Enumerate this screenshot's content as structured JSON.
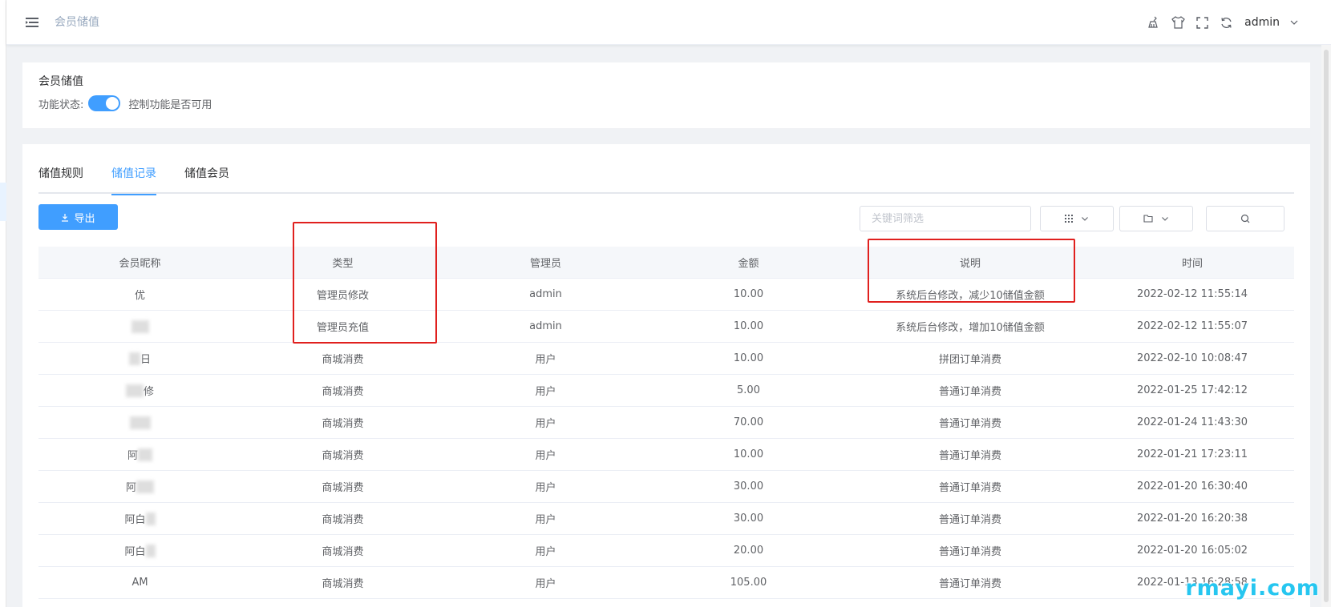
{
  "header": {
    "breadcrumb": "会员储值",
    "username": "admin"
  },
  "status_card": {
    "title": "会员储值",
    "status_label": "功能状态:",
    "switch_on": true,
    "switch_hint": "控制功能是否可用"
  },
  "tabs": [
    {
      "label": "储值规则"
    },
    {
      "label": "储值记录"
    },
    {
      "label": "储值会员"
    }
  ],
  "toolbar": {
    "export_label": "导出",
    "keyword_placeholder": "关键词筛选"
  },
  "table": {
    "columns": [
      "会员昵称",
      "类型",
      "管理员",
      "金额",
      "说明",
      "时间"
    ],
    "rows": [
      {
        "nickname": "优",
        "type": "管理员修改",
        "admin": "admin",
        "amount": "10.00",
        "note": "系统后台修改，减少10储值金额",
        "time": "2022-02-12 11:55:14"
      },
      {
        "nickname": "",
        "type": "管理员充值",
        "admin": "admin",
        "amount": "10.00",
        "note": "系统后台修改，增加10储值金额",
        "time": "2022-02-12 11:55:07"
      },
      {
        "nickname": "日",
        "type": "商城消费",
        "admin": "用户",
        "amount": "10.00",
        "note": "拼团订单消费",
        "time": "2022-02-10 10:08:47"
      },
      {
        "nickname": "修",
        "type": "商城消费",
        "admin": "用户",
        "amount": "5.00",
        "note": "普通订单消费",
        "time": "2022-01-25 17:42:12"
      },
      {
        "nickname": "",
        "type": "商城消费",
        "admin": "用户",
        "amount": "70.00",
        "note": "普通订单消费",
        "time": "2022-01-24 11:43:30"
      },
      {
        "nickname": "阿",
        "type": "商城消费",
        "admin": "用户",
        "amount": "10.00",
        "note": "普通订单消费",
        "time": "2022-01-21 17:23:11"
      },
      {
        "nickname": "阿",
        "type": "商城消费",
        "admin": "用户",
        "amount": "30.00",
        "note": "普通订单消费",
        "time": "2022-01-20 16:30:40"
      },
      {
        "nickname": "阿白",
        "type": "商城消费",
        "admin": "用户",
        "amount": "30.00",
        "note": "普通订单消费",
        "time": "2022-01-20 16:20:38"
      },
      {
        "nickname": "阿白",
        "type": "商城消费",
        "admin": "用户",
        "amount": "20.00",
        "note": "普通订单消费",
        "time": "2022-01-20 16:05:02"
      },
      {
        "nickname": "AM",
        "type": "商城消费",
        "admin": "用户",
        "amount": "105.00",
        "note": "普通订单消费",
        "time": "2022-01-13 16:28:58"
      }
    ]
  },
  "watermark": "rmayi.com",
  "colors": {
    "primary": "#409eff",
    "annotation": "#e0201e",
    "watermark": "#26c6f0"
  },
  "icons": {
    "menu": "hamburger-icon",
    "clean": "broom-icon",
    "theme": "tshirt-icon",
    "fullscreen": "fullscreen-icon",
    "refresh": "refresh-icon",
    "export": "download-icon",
    "columns": "grid-icon",
    "folder": "folder-icon",
    "search": "search-icon"
  }
}
